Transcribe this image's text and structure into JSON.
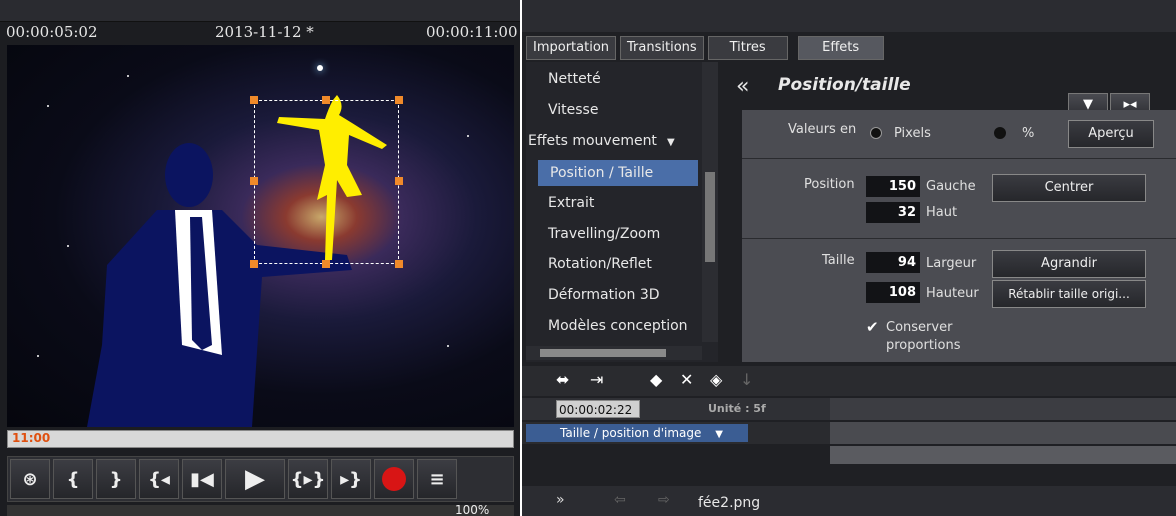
{
  "preview": {
    "timecode_start": "00:00:05:02",
    "date": "2013-11-12 *",
    "timecode_end": "00:00:11:00",
    "ruler_time": "11:00",
    "zoom": "100%"
  },
  "transport": {
    "buttons": [
      "{",
      "}",
      "{◂",
      "▮◀",
      "▶",
      "{▸}",
      "▸}"
    ]
  },
  "tabs": [
    "Importation",
    "Transitions",
    "Titres",
    "Effets"
  ],
  "effects": [
    {
      "label": "Netteté"
    },
    {
      "label": "Vitesse"
    },
    {
      "label": "Effets mouvement"
    },
    {
      "label": "Position / Taille"
    },
    {
      "label": "Extrait"
    },
    {
      "label": "Travelling/Zoom"
    },
    {
      "label": "Rotation/Reflet"
    },
    {
      "label": "Déformation 3D"
    },
    {
      "label": "Modèles conception"
    }
  ],
  "panel": {
    "back_glyph": "«",
    "title": "Position/taille",
    "btn_down": "▼",
    "btn_fit": "▸◂",
    "values_label": "Valeurs en",
    "pixels": "Pixels",
    "percent": "%",
    "apercu": "Aperçu",
    "position_label": "Position",
    "pos_left": "150",
    "left_label": "Gauche",
    "pos_top": "32",
    "top_label": "Haut",
    "center_btn": "Centrer",
    "size_label": "Taille",
    "width": "94",
    "width_label": "Largeur",
    "height": "108",
    "height_label": "Hauteur",
    "enlarge_btn": "Agrandir",
    "reset_btn": "Rétablir taille origi...",
    "keep_line1": "Conserver",
    "keep_line2": "proportions"
  },
  "timeline": {
    "time": "00:00:02:22",
    "unit": "Unité :  5f",
    "track": "Taille / position d'image"
  },
  "footer": {
    "file": "fée2.png"
  }
}
